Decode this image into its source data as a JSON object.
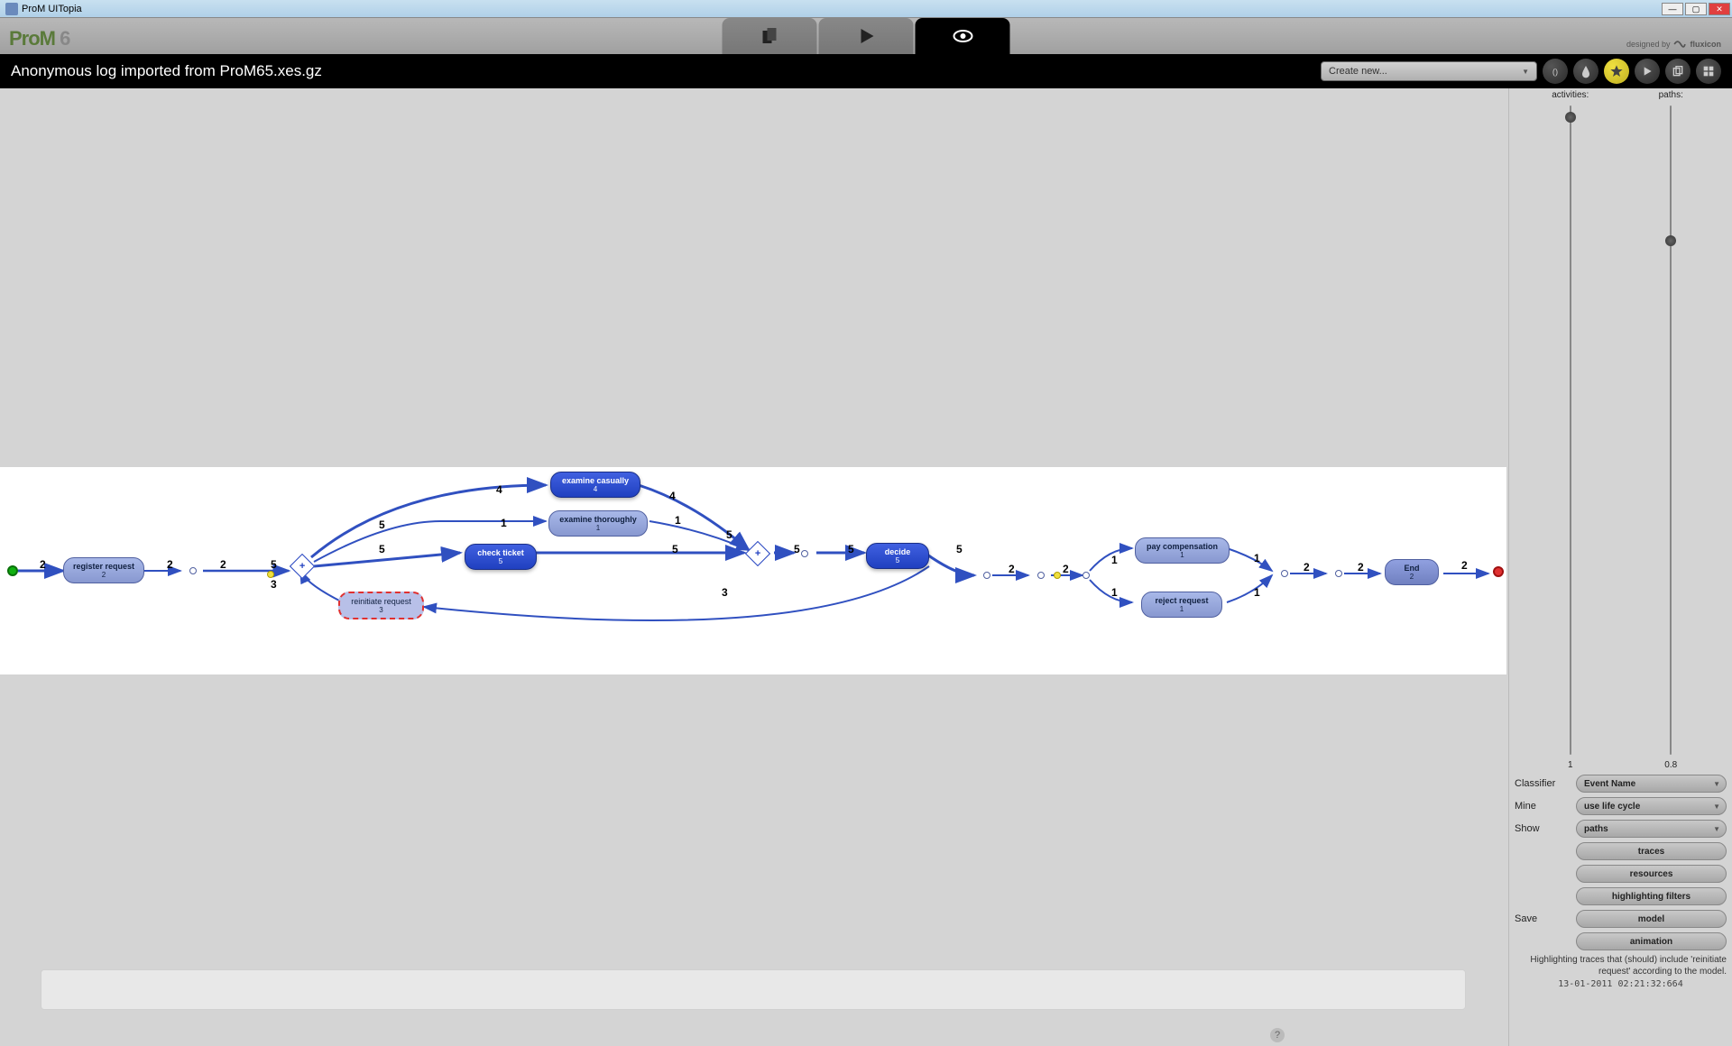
{
  "window": {
    "title": "ProM UITopia"
  },
  "logo": {
    "text": "ProM",
    "suffix": "6"
  },
  "designed_by": {
    "label": "designed by",
    "company": "fluxicon"
  },
  "page": {
    "title": "Anonymous log imported from ProM65.xes.gz"
  },
  "secondary": {
    "create_new": "Create new..."
  },
  "sliders": {
    "activities": {
      "label": "activities:",
      "bottom": "1",
      "pos_pct": 1
    },
    "paths": {
      "label": "paths:",
      "bottom": "0.8",
      "pos_pct": 20
    }
  },
  "controls": {
    "classifier": {
      "label": "Classifier",
      "value": "Event Name"
    },
    "mine": {
      "label": "Mine",
      "value": "use life cycle"
    },
    "show": {
      "label": "Show",
      "value": "paths"
    },
    "buttons": {
      "traces": "traces",
      "resources": "resources",
      "highlighting_filters": "highlighting filters",
      "model": "model",
      "animation": "animation"
    },
    "save_label": "Save"
  },
  "hint": "Highlighting traces that (should) include 'reinitiate request' according to the model.",
  "timestamp": "13-01-2011 02:21:32:664",
  "diagram": {
    "nodes": {
      "register_request": {
        "label": "register request",
        "count": "2"
      },
      "reinitiate_request": {
        "label": "reinitiate request",
        "count": "3"
      },
      "examine_casually": {
        "label": "examine casually",
        "count": "4"
      },
      "examine_thoroughly": {
        "label": "examine thoroughly",
        "count": "1"
      },
      "check_ticket": {
        "label": "check ticket",
        "count": "5"
      },
      "decide": {
        "label": "decide",
        "count": "5"
      },
      "pay_compensation": {
        "label": "pay compensation",
        "count": "1"
      },
      "reject_request": {
        "label": "reject request",
        "count": "1"
      },
      "end": {
        "label": "End",
        "count": "2"
      }
    },
    "edges": {
      "e_start": "2",
      "e_reg_out1": "2",
      "e_reg_out2": "2",
      "e_gw_5a": "5",
      "e_gw_5b": "5",
      "e_gw_3": "3",
      "e_ec_in": "4",
      "e_ec_out": "4",
      "e_et_in": "1",
      "e_et_out": "1",
      "e_ct_in": "5",
      "e_ct_out": "5",
      "e_ct_5b": "5",
      "e_dec_in": "5",
      "e_dec_out": "5",
      "e_rein_out": "3",
      "e_post_dec1": "2",
      "e_post_dec2": "2",
      "e_pc_in": "1",
      "e_pc_out": "1",
      "e_rr_in": "1",
      "e_rr_out": "1",
      "e_end_in1": "2",
      "e_end_in2": "2",
      "e_end_out": "2"
    }
  }
}
